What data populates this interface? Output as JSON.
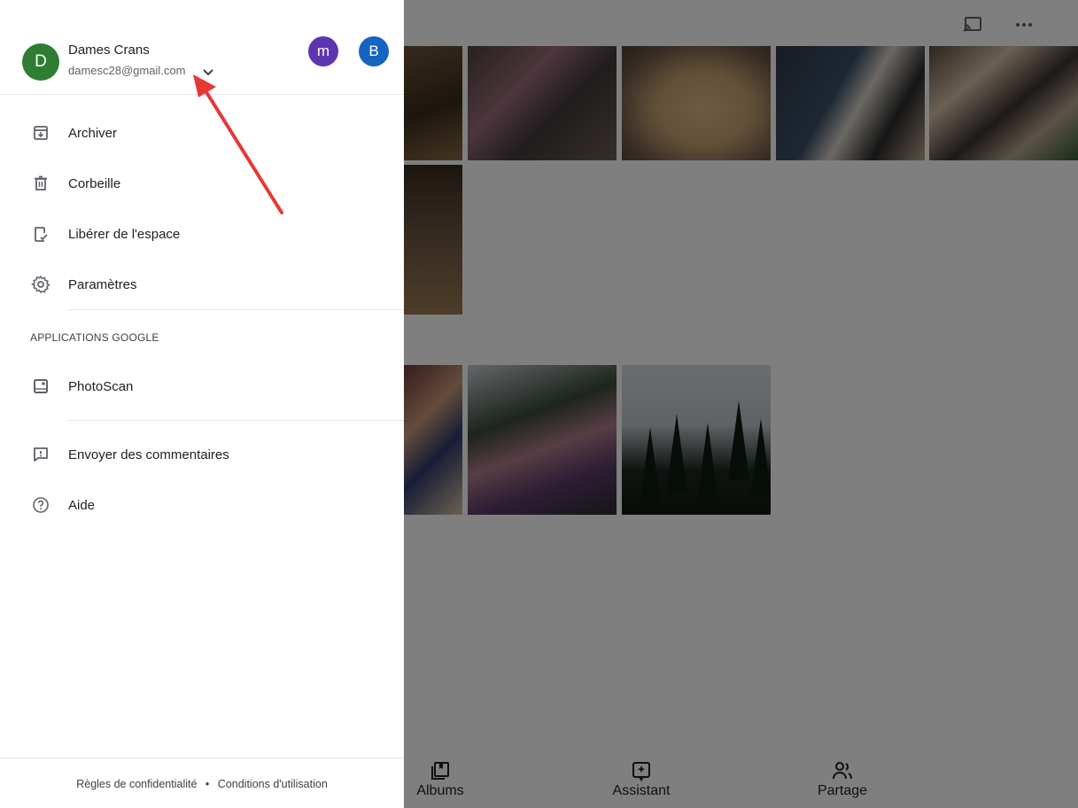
{
  "drawer": {
    "account": {
      "avatar_letter": "D",
      "name": "Dames Crans",
      "email": "damesc28@gmail.com",
      "other_accounts": [
        "m",
        "B"
      ]
    },
    "items": [
      {
        "label": "Archiver",
        "icon": "archive-icon"
      },
      {
        "label": "Corbeille",
        "icon": "trash-icon"
      },
      {
        "label": "Libérer de l'espace",
        "icon": "free-space-icon"
      },
      {
        "label": "Paramètres",
        "icon": "settings-icon"
      }
    ],
    "section_label": "APPLICATIONS GOOGLE",
    "apps": [
      {
        "label": "PhotoScan",
        "icon": "photoscan-icon"
      }
    ],
    "support": [
      {
        "label": "Envoyer des commentaires",
        "icon": "feedback-icon"
      },
      {
        "label": "Aide",
        "icon": "help-icon"
      }
    ],
    "footer": {
      "privacy": "Règles de confidentialité",
      "separator": "•",
      "terms": "Conditions d'utilisation"
    }
  },
  "background_app": {
    "top_icons": [
      "cast-icon",
      "more-icon"
    ],
    "tabs": [
      {
        "label": "Albums",
        "icon": "albums-icon"
      },
      {
        "label": "Assistant",
        "icon": "assistant-icon"
      },
      {
        "label": "Partage",
        "icon": "sharing-icon"
      }
    ]
  },
  "colors": {
    "primary_avatar": "#2e7d32",
    "avatar_m": "#5e35b1",
    "avatar_b": "#1565c0",
    "annotation_arrow": "#e53935",
    "scrim": "rgba(0,0,0,0.5)"
  }
}
